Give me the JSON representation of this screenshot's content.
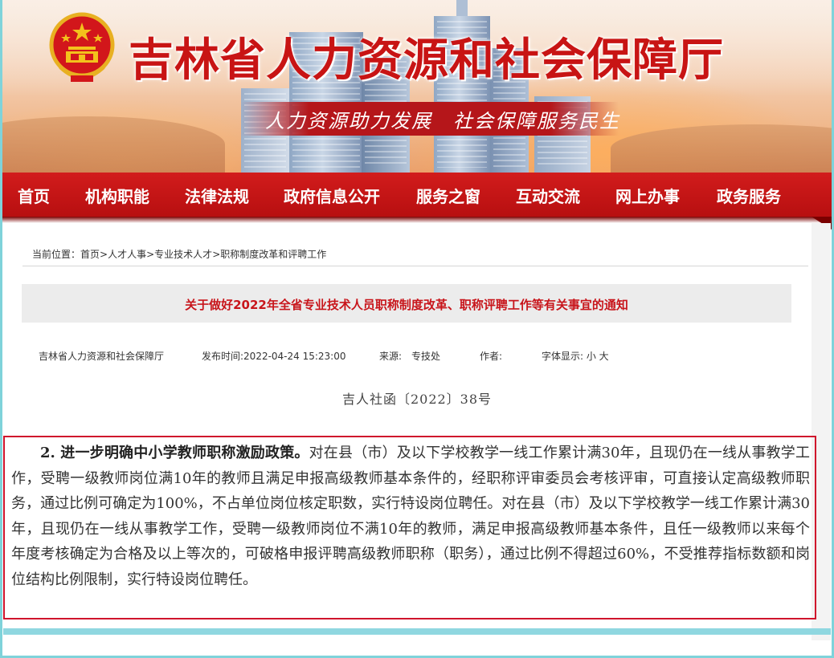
{
  "banner": {
    "site_title": "吉林省人力资源和社会保障厅",
    "slogan": "人力资源助力发展　社会保障服务民生"
  },
  "nav": {
    "items": [
      "首页",
      "机构职能",
      "法律法规",
      "政府信息公开",
      "服务之窗",
      "互动交流",
      "网上办事",
      "政务服务"
    ]
  },
  "breadcrumb": {
    "prefix": "当前位置：",
    "items": [
      "首页",
      "人才人事",
      "专业技术人才",
      "职称制度改革和评聘工作"
    ],
    "separator": ">"
  },
  "article": {
    "title": "关于做好2022年全省专业技术人员职称制度改革、职称评聘工作等有关事宜的通知",
    "publisher": "吉林省人力资源和社会保障厅",
    "publish_time": "发布时间:2022-04-24 15:23:00",
    "source": "来源:　专技处",
    "author": "作者:",
    "font_size": "字体显示: 小 大",
    "doc_number": "吉人社函〔2022〕38号",
    "highlight_lead": "2. 进一步明确中小学教师职称激励政策。",
    "highlight_body": "对在县（市）及以下学校教学一线工作累计满30年，且现仍在一线从事教学工作，受聘一级教师岗位满10年的教师且满足申报高级教师基本条件的，经职称评审委员会考核评审，可直接认定高级教师职务，通过比例可确定为100%，不占单位岗位核定职数，实行特设岗位聘任。对在县（市）及以下学校教学一线工作累计满30年，且现仍在一线从事教学工作，受聘一级教师岗位不满10年的教师，满足申报高级教师基本条件，且任一级教师以来每个年度考核确定为合格及以上等次的，可破格申报评聘高级教师职称（职务），通过比例不得超过60%，不受推荐指标数额和岗位结构比例限制，实行特设岗位聘任。"
  },
  "colors": {
    "brand_red": "#c81414",
    "nav_red": "#c4161a",
    "highlight_border": "#d0142c",
    "frame_teal": "#7fd3da"
  }
}
